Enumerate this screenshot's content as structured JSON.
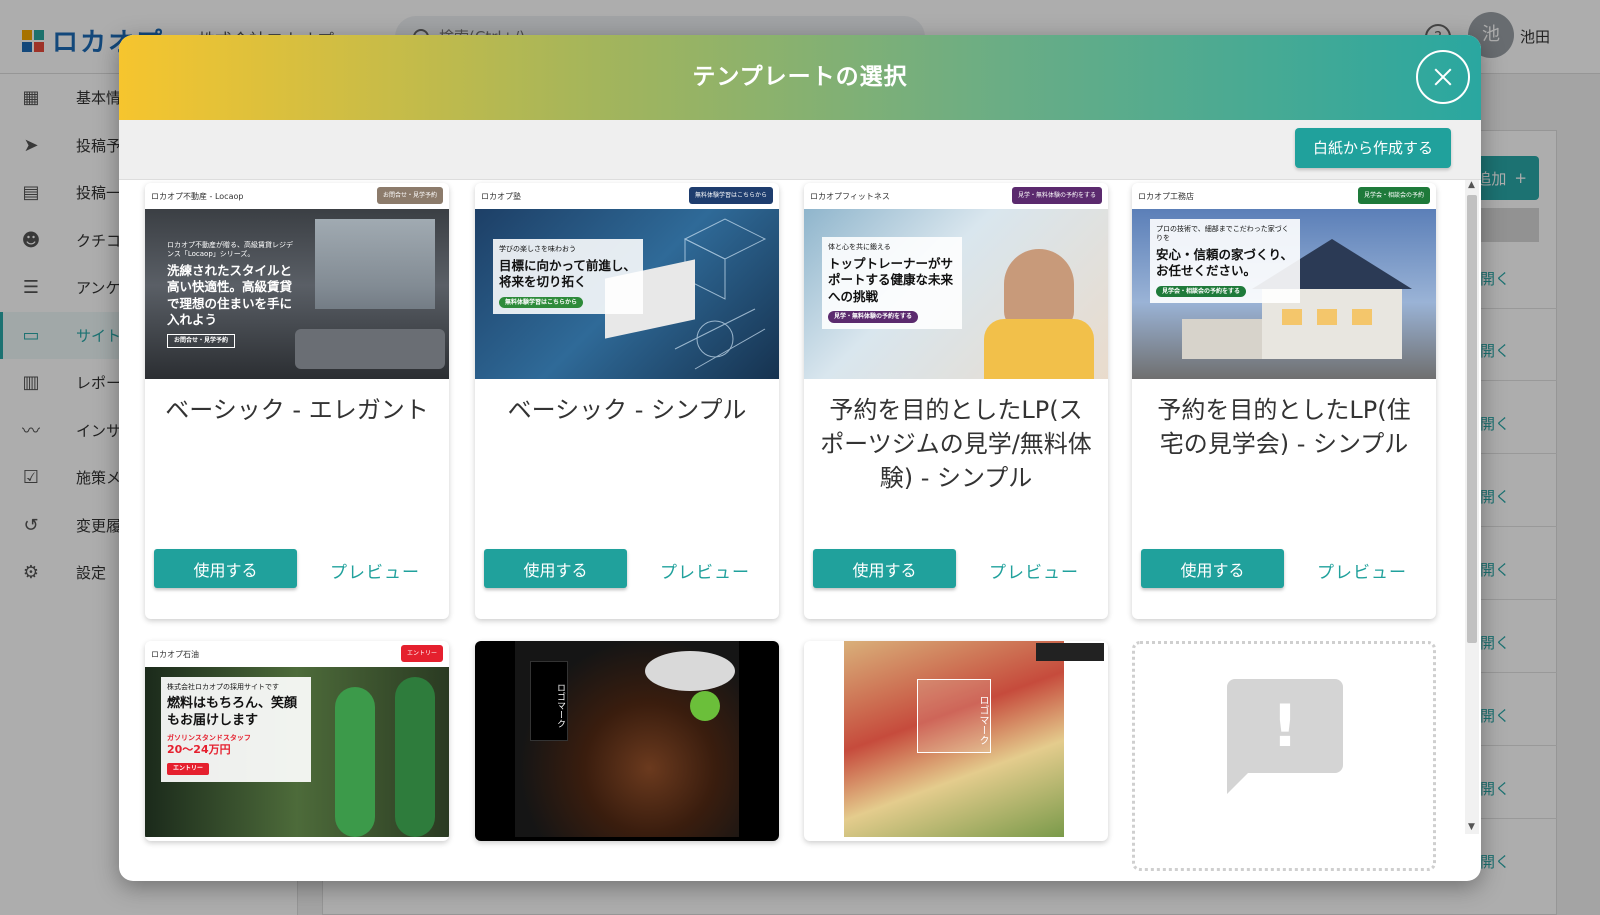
{
  "app": {
    "logo_text": "ロカオプ",
    "company": "株式会社ロカオプ",
    "search_placeholder": "検索(Ctrl+/)",
    "avatar_initial": "池",
    "username": "池田"
  },
  "sidebar": {
    "items": [
      {
        "label": "基本情報",
        "icon": "store-icon"
      },
      {
        "label": "投稿予約",
        "icon": "send-icon"
      },
      {
        "label": "投稿一覧",
        "icon": "document-icon"
      },
      {
        "label": "クチコミ",
        "icon": "review-icon"
      },
      {
        "label": "アンケート",
        "icon": "list-icon"
      },
      {
        "label": "サイト",
        "icon": "browser-icon"
      },
      {
        "label": "レポート",
        "icon": "report-icon"
      },
      {
        "label": "インサイト",
        "icon": "chart-line-icon"
      },
      {
        "label": "施策メモ",
        "icon": "checklist-icon"
      },
      {
        "label": "変更履歴",
        "icon": "history-icon"
      },
      {
        "label": "設定",
        "icon": "gear-icon"
      }
    ]
  },
  "background": {
    "add_label": "追加",
    "open_label": "開く"
  },
  "modal": {
    "title": "テンプレートの選択",
    "blank_button": "白紙から作成する",
    "use_label": "使用する",
    "preview_label": "プレビュー",
    "templates": [
      {
        "title": "ベーシック - エレガント",
        "thumb_brand": "ロカオプ不動産 - Locaop",
        "thumb_nav_button": "お問合せ・見学予約",
        "thumb_small": "ロカオプ不動産が贈る、高級賃貸レジデンス「Locaop」シリーズ。",
        "thumb_headline": "洗練されたスタイルと高い快適性。高級賃貸で理想の住まいを手に入れよう",
        "thumb_cta": "お問合せ・見学予約"
      },
      {
        "title": "ベーシック - シンプル",
        "thumb_brand": "ロカオプ塾",
        "thumb_nav_button": "無料体験学習はこちらから",
        "thumb_small": "学びの楽しさを味わおう",
        "thumb_headline": "目標に向かって前進し、将来を切り拓く",
        "thumb_cta": "無料体験学習はこちらから"
      },
      {
        "title": "予約を目的としたLP(スポーツジムの見学/無料体験) - シンプル",
        "thumb_brand": "ロカオプフィットネス",
        "thumb_nav_button": "見学・無料体験の予約をする",
        "thumb_small": "体と心を共に鍛える",
        "thumb_headline": "トップトレーナーがサポートする健康な未来への挑戦",
        "thumb_cta": "見学・無料体験の予約をする"
      },
      {
        "title": "予約を目的としたLP(住宅の見学会) - シンプル",
        "thumb_brand": "ロカオプ工務店",
        "thumb_nav_button": "見学会・相談会の予約",
        "thumb_small": "プロの技術で、細部までこだわった家づくりを",
        "thumb_headline": "安心・信頼の家づくり、お任せください。",
        "thumb_cta": "見学会・相談会の予約をする"
      },
      {
        "thumb_brand": "ロカオプ石油",
        "thumb_nav_button": "エントリー",
        "thumb_small": "株式会社ロカオプの採用サイトです",
        "thumb_headline": "燃料はもちろん、笑顔もお届けします",
        "thumb_job": "ガソリンスタンドスタッフ",
        "thumb_salary": "20〜24万円",
        "thumb_cta": "エントリー"
      },
      {
        "thumb_logo": "ロゴマーク"
      },
      {
        "thumb_logo": "ロゴマーク"
      }
    ]
  },
  "colors": {
    "accent": "#20a19c",
    "header_gradient_start": "#f6c52e",
    "header_gradient_end": "#2aa7a0"
  }
}
